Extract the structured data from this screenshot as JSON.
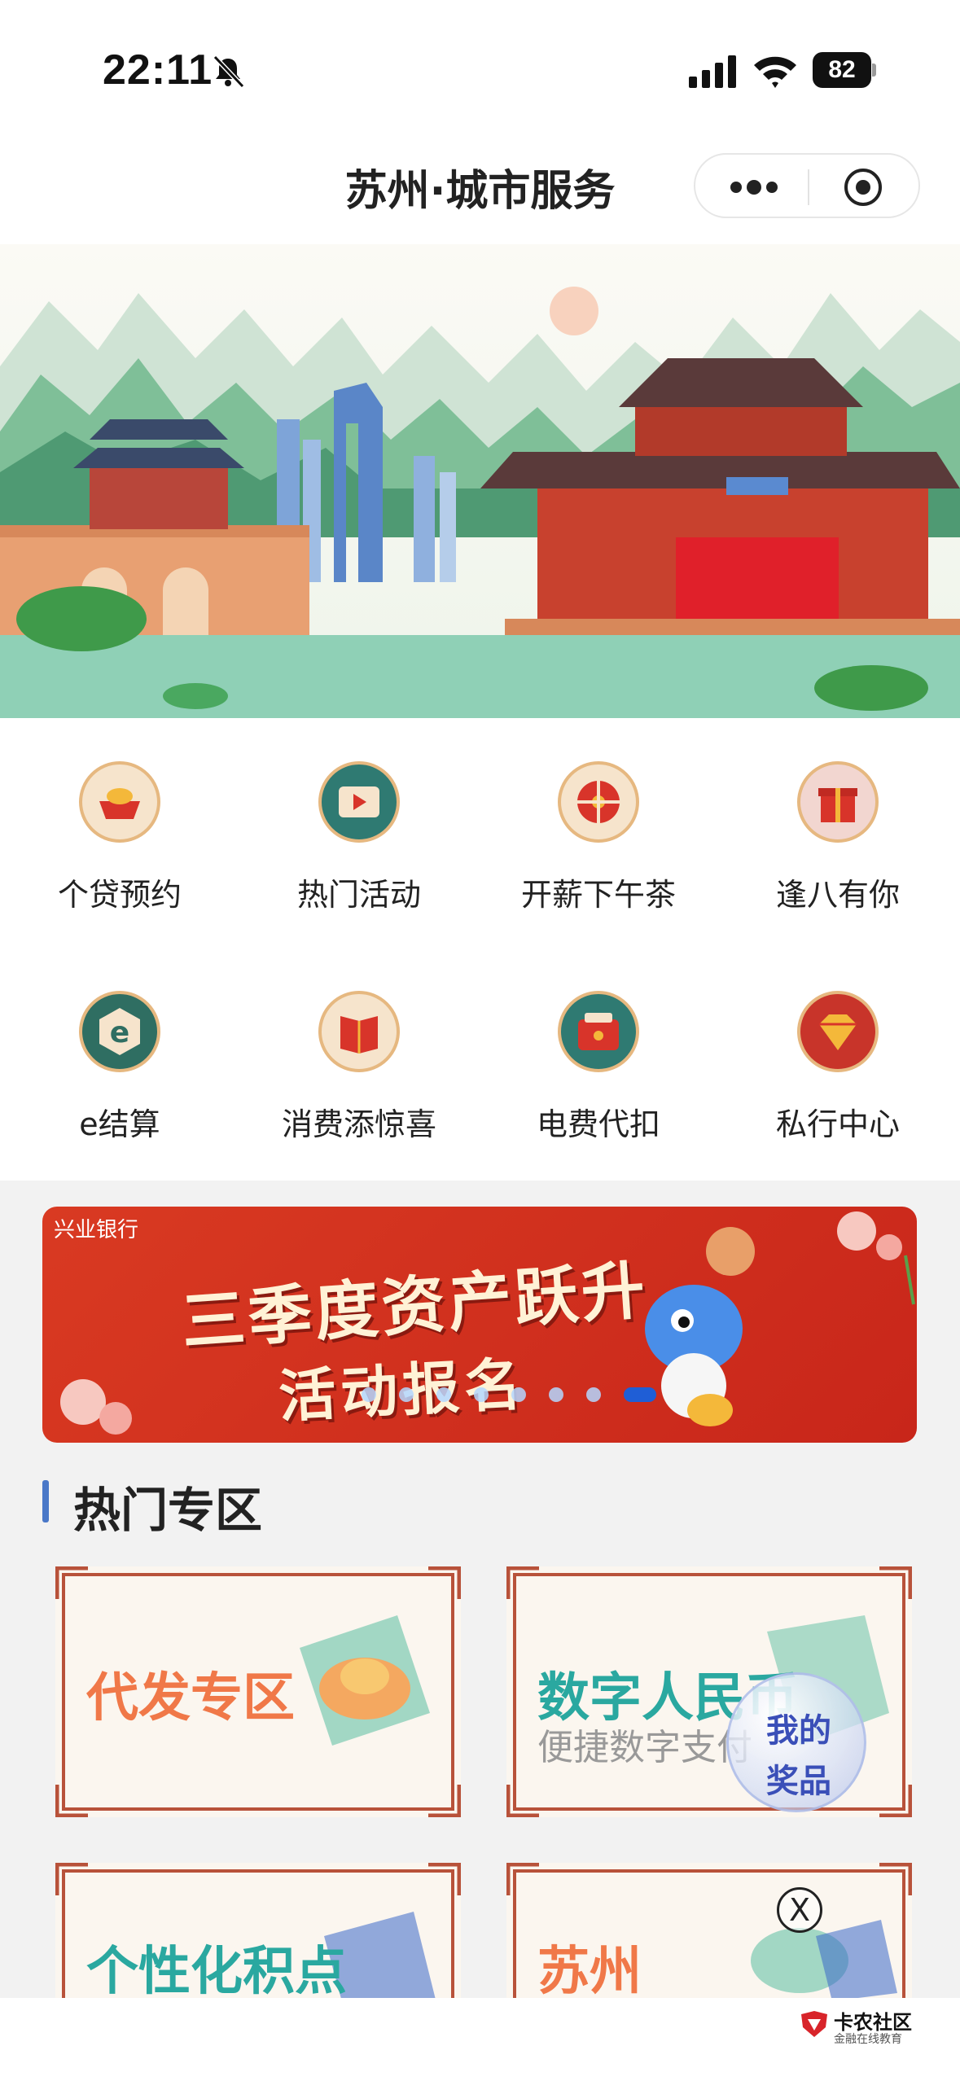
{
  "status_bar": {
    "time": "22:11",
    "battery": "82"
  },
  "nav": {
    "title": "苏州·城市服务"
  },
  "grid": {
    "items": [
      {
        "label": "个贷预约",
        "icon": "ingot-icon"
      },
      {
        "label": "热门活动",
        "icon": "video-play-icon"
      },
      {
        "label": "开薪下午茶",
        "icon": "wheel-icon"
      },
      {
        "label": "逢八有你",
        "icon": "gift-icon"
      },
      {
        "label": "e结算",
        "icon": "e-settle-icon"
      },
      {
        "label": "消费添惊喜",
        "icon": "book-icon"
      },
      {
        "label": "电费代扣",
        "icon": "wallet-icon"
      },
      {
        "label": "私行中心",
        "icon": "diamond-icon"
      }
    ]
  },
  "promo": {
    "bank": "兴业银行",
    "line1": "三季度资产跃升",
    "line2": "活动报名",
    "dots_total": 8,
    "active_dot": 8
  },
  "section": {
    "title": "热门专区"
  },
  "cards": [
    {
      "title": "代发专区",
      "subtitle": "",
      "color": "#f07848"
    },
    {
      "title": "数字人民币",
      "subtitle": "便捷数字支付",
      "color": "#2aa8a0"
    },
    {
      "title": "个性化积点",
      "subtitle": "",
      "color": "#2aa8a0"
    },
    {
      "title": "苏州",
      "subtitle": "",
      "color": "#f07848"
    }
  ],
  "prize": {
    "line1": "我的",
    "line2": "奖品"
  },
  "close": {
    "label": "X"
  },
  "watermark": {
    "title": "卡农社区",
    "subtitle": "金融在线教育"
  },
  "colors": {
    "accent_blue": "#4a78c8",
    "promo_red": "#d93a22",
    "frame_red": "#b8523a"
  }
}
